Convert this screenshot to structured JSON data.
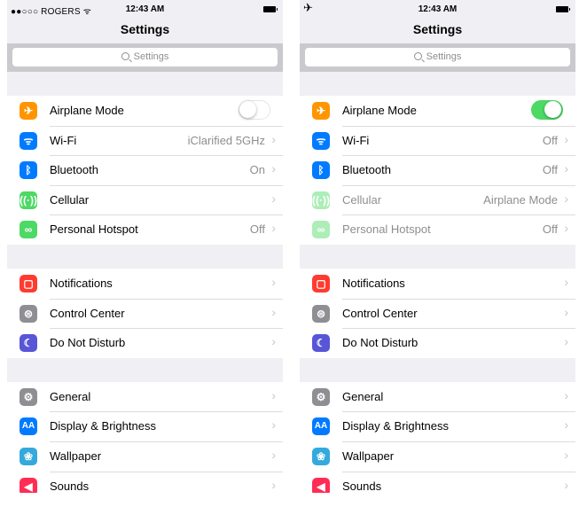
{
  "left": {
    "status": {
      "carrier": "●●○○○ ROGERS ᯤ",
      "time": "12:43 AM"
    },
    "title": "Settings",
    "search_placeholder": "Settings",
    "groups": [
      [
        {
          "label": "Airplane Mode",
          "toggle": "off",
          "icon": "airplane-icon"
        },
        {
          "label": "Wi-Fi",
          "value": "iClarified 5GHz",
          "icon": "wifi-icon"
        },
        {
          "label": "Bluetooth",
          "value": "On",
          "icon": "bluetooth-icon"
        },
        {
          "label": "Cellular",
          "value": "",
          "icon": "cellular-icon"
        },
        {
          "label": "Personal Hotspot",
          "value": "Off",
          "icon": "hotspot-icon"
        }
      ],
      [
        {
          "label": "Notifications",
          "icon": "notifications-icon"
        },
        {
          "label": "Control Center",
          "icon": "control-center-icon"
        },
        {
          "label": "Do Not Disturb",
          "icon": "moon-icon"
        }
      ],
      [
        {
          "label": "General",
          "icon": "gear-icon"
        },
        {
          "label": "Display & Brightness",
          "icon": "display-icon"
        },
        {
          "label": "Wallpaper",
          "icon": "wallpaper-icon"
        },
        {
          "label": "Sounds",
          "icon": "speaker-icon"
        }
      ]
    ]
  },
  "right": {
    "status": {
      "carrier": "✈",
      "time": "12:43 AM"
    },
    "title": "Settings",
    "search_placeholder": "Settings",
    "groups": [
      [
        {
          "label": "Airplane Mode",
          "toggle": "on",
          "icon": "airplane-icon"
        },
        {
          "label": "Wi-Fi",
          "value": "Off",
          "icon": "wifi-icon"
        },
        {
          "label": "Bluetooth",
          "value": "Off",
          "icon": "bluetooth-icon"
        },
        {
          "label": "Cellular",
          "value": "Airplane Mode",
          "icon": "cellular-icon",
          "disabled": true
        },
        {
          "label": "Personal Hotspot",
          "value": "Off",
          "icon": "hotspot-icon",
          "disabled": true
        }
      ],
      [
        {
          "label": "Notifications",
          "icon": "notifications-icon"
        },
        {
          "label": "Control Center",
          "icon": "control-center-icon"
        },
        {
          "label": "Do Not Disturb",
          "icon": "moon-icon"
        }
      ],
      [
        {
          "label": "General",
          "icon": "gear-icon"
        },
        {
          "label": "Display & Brightness",
          "icon": "display-icon"
        },
        {
          "label": "Wallpaper",
          "icon": "wallpaper-icon"
        },
        {
          "label": "Sounds",
          "icon": "speaker-icon"
        }
      ]
    ]
  },
  "colors": {
    "orange": "#ff9500",
    "blue": "#007aff",
    "green": "#4cd964",
    "red": "#ff3b30",
    "gray": "#8e8e93",
    "purple": "#5856d6",
    "cyan": "#34aadc",
    "pink": "#ff2d55"
  }
}
